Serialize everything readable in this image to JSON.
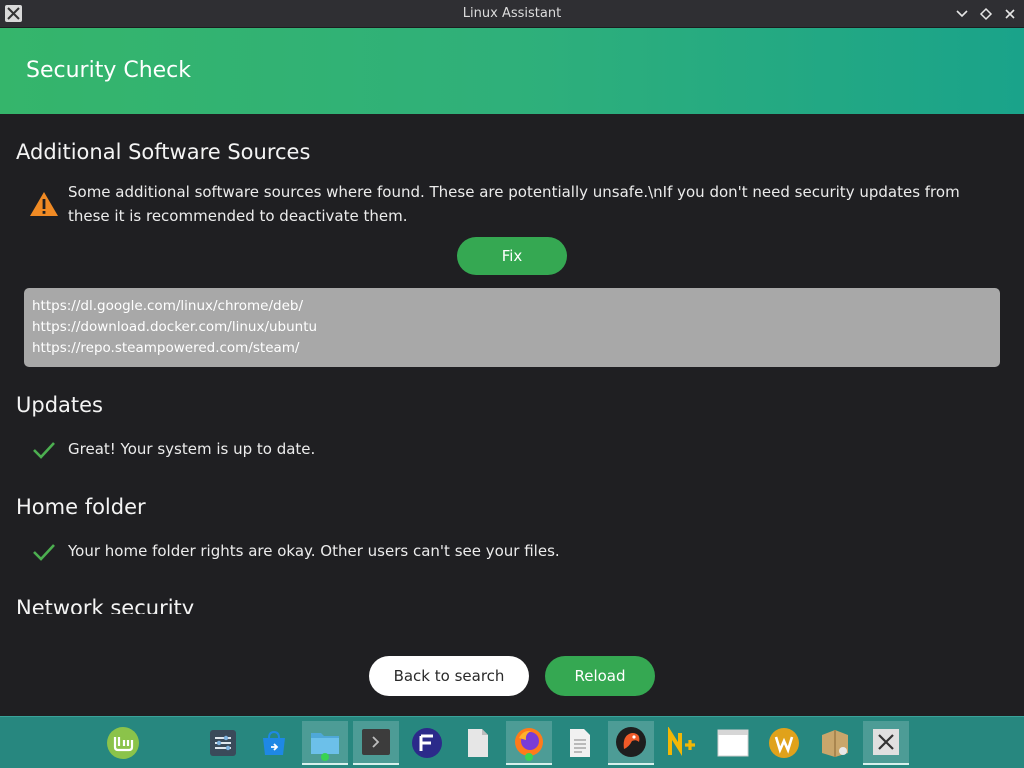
{
  "window": {
    "title": "Linux Assistant"
  },
  "header": {
    "title": "Security Check"
  },
  "sections": {
    "sources": {
      "title": "Additional Software Sources",
      "message_line1": "Some additional software sources where found. These are potentially unsafe.\\nIf you don't need security updates from",
      "message_line2": "these it is recommended to deactivate them.",
      "fix_label": "Fix",
      "items": [
        "https://dl.google.com/linux/chrome/deb/",
        "https://download.docker.com/linux/ubuntu",
        "https://repo.steampowered.com/steam/"
      ]
    },
    "updates": {
      "title": "Updates",
      "message": "Great! Your system is up to date."
    },
    "home": {
      "title": "Home folder",
      "message": "Your home folder rights are okay. Other users can't see your files."
    },
    "network": {
      "title": "Network security"
    }
  },
  "footer": {
    "back_label": "Back to search",
    "reload_label": "Reload"
  },
  "colors": {
    "accent_green": "#35a852",
    "header_gradient_start": "#35b56b",
    "header_gradient_end": "#1aa38a",
    "warning": "#f08a24",
    "check": "#4caf50",
    "taskbar": "#27877f"
  },
  "taskbar": {
    "items": [
      {
        "icon": "linux-mint-menu-icon"
      },
      {
        "icon": "settings-sliders-icon"
      },
      {
        "icon": "software-store-icon"
      },
      {
        "icon": "file-manager-icon"
      },
      {
        "icon": "terminal-icon"
      },
      {
        "icon": "app-f-icon"
      },
      {
        "icon": "blank-document-icon"
      },
      {
        "icon": "firefox-icon"
      },
      {
        "icon": "text-document-icon"
      },
      {
        "icon": "parrot-app-icon"
      },
      {
        "icon": "notepadqq-icon"
      },
      {
        "icon": "window-icon"
      },
      {
        "icon": "app-w-icon"
      },
      {
        "icon": "archive-manager-icon"
      },
      {
        "icon": "linux-assistant-icon"
      }
    ]
  }
}
